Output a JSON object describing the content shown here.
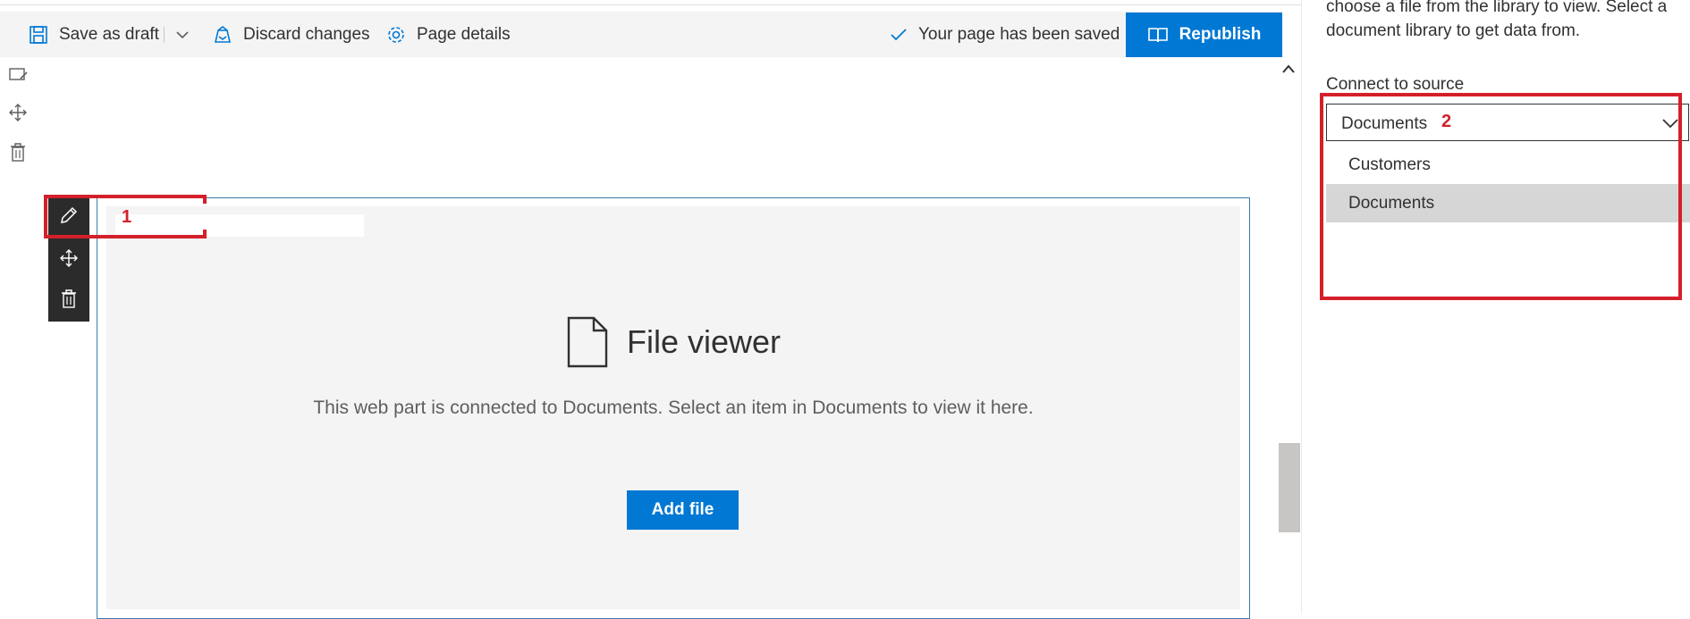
{
  "command_bar": {
    "save_label": "Save as draft",
    "discard_label": "Discard changes",
    "page_details_label": "Page details",
    "status_text": "Your page has been saved",
    "republish_label": "Republish"
  },
  "webpart": {
    "title": "File viewer",
    "description": "This web part is connected to Documents. Select an item in Documents to view it here.",
    "add_file_label": "Add file"
  },
  "property_pane": {
    "description": "choose a file from the library to view. Select a document library to get data from.",
    "connect_label": "Connect to source",
    "dropdown_value": "Documents",
    "options": [
      {
        "label": "Customers",
        "selected": false
      },
      {
        "label": "Documents",
        "selected": true
      }
    ]
  },
  "annotations": {
    "marker_1": "1",
    "marker_2": "2"
  },
  "colors": {
    "accent": "#0078d4",
    "annotation": "#d4202a",
    "toolbar_dark": "#2b2b2b"
  }
}
